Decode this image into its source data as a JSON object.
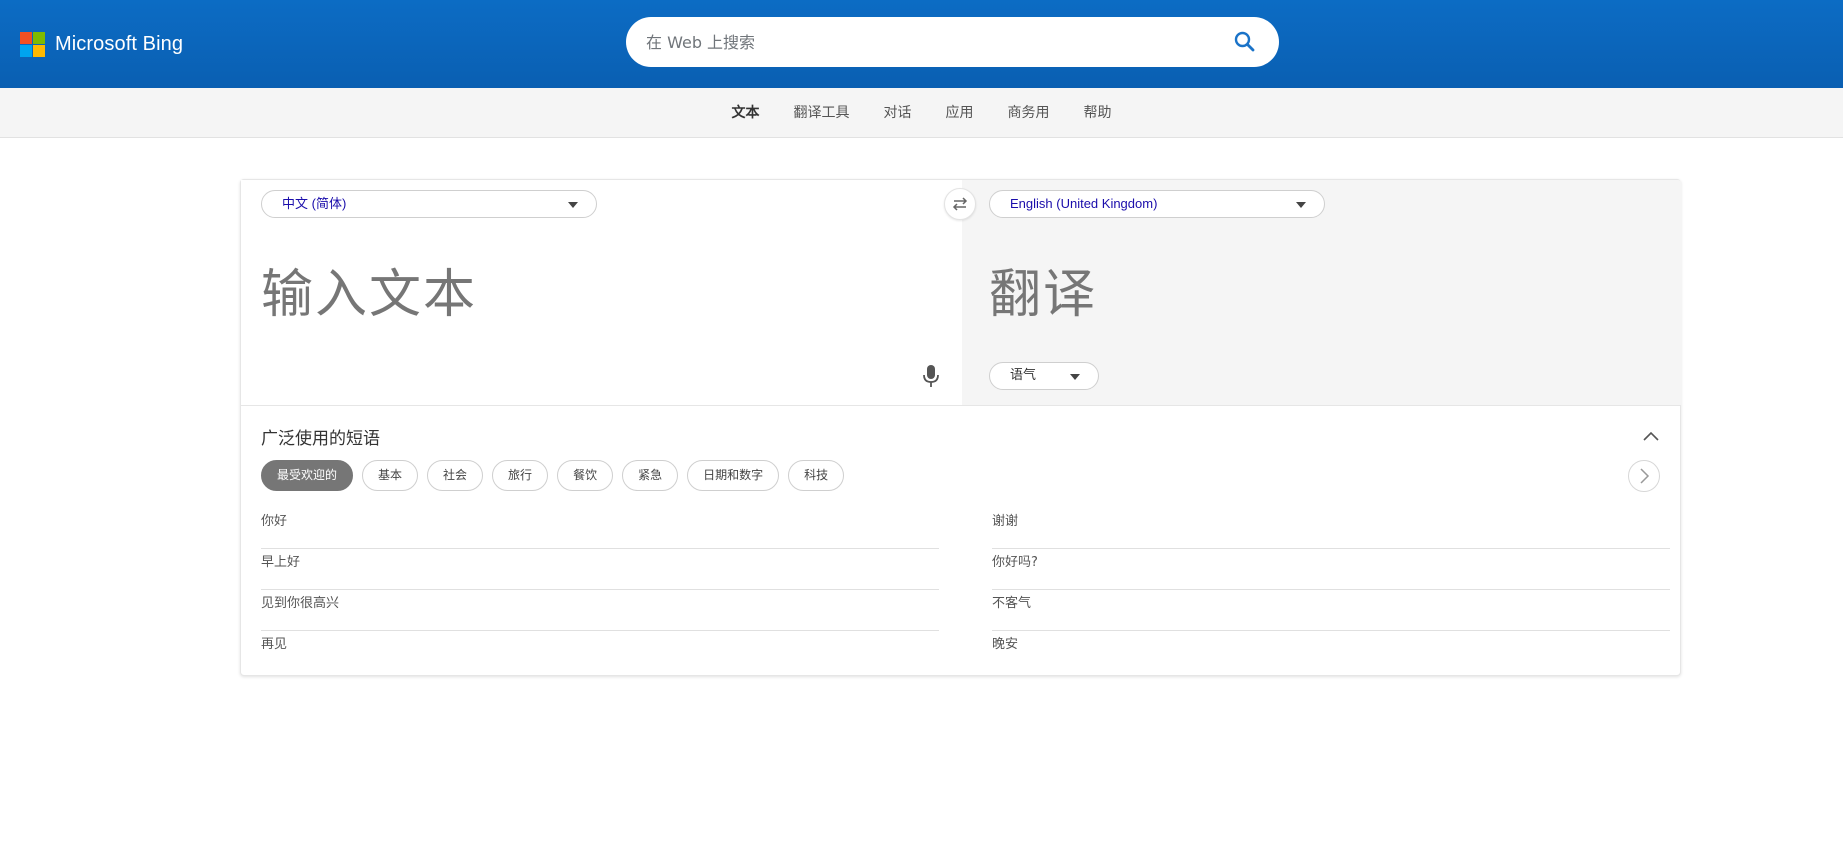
{
  "brand": {
    "name": "Microsoft Bing",
    "colors": {
      "red": "#f25022",
      "green": "#7fba00",
      "blue": "#00a4ef",
      "yellow": "#ffb900",
      "header": "#0b63b9"
    }
  },
  "search": {
    "placeholder": "在 Web 上搜索",
    "value": "",
    "icon": "search-icon"
  },
  "nav": {
    "items": [
      {
        "label": "文本",
        "active": true
      },
      {
        "label": "翻译工具",
        "active": false
      },
      {
        "label": "对话",
        "active": false
      },
      {
        "label": "应用",
        "active": false
      },
      {
        "label": "商务用",
        "active": false
      },
      {
        "label": "帮助",
        "active": false
      }
    ]
  },
  "translator": {
    "source_language": "中文 (简体)",
    "target_language": "English (United Kingdom)",
    "input_placeholder": "输入文本",
    "output_placeholder": "翻译",
    "tone_label": "语气",
    "icons": {
      "swap": "swap-icon",
      "mic": "microphone-icon"
    }
  },
  "phrases": {
    "title": "广泛使用的短语",
    "categories": [
      {
        "label": "最受欢迎的",
        "active": true
      },
      {
        "label": "基本",
        "active": false
      },
      {
        "label": "社会",
        "active": false
      },
      {
        "label": "旅行",
        "active": false
      },
      {
        "label": "餐饮",
        "active": false
      },
      {
        "label": "紧急",
        "active": false
      },
      {
        "label": "日期和数字",
        "active": false
      },
      {
        "label": "科技",
        "active": false
      }
    ],
    "left": [
      "你好",
      "早上好",
      "见到你很高兴",
      "再见"
    ],
    "right": [
      "谢谢",
      "你好吗?",
      "不客气",
      "晚安"
    ]
  }
}
